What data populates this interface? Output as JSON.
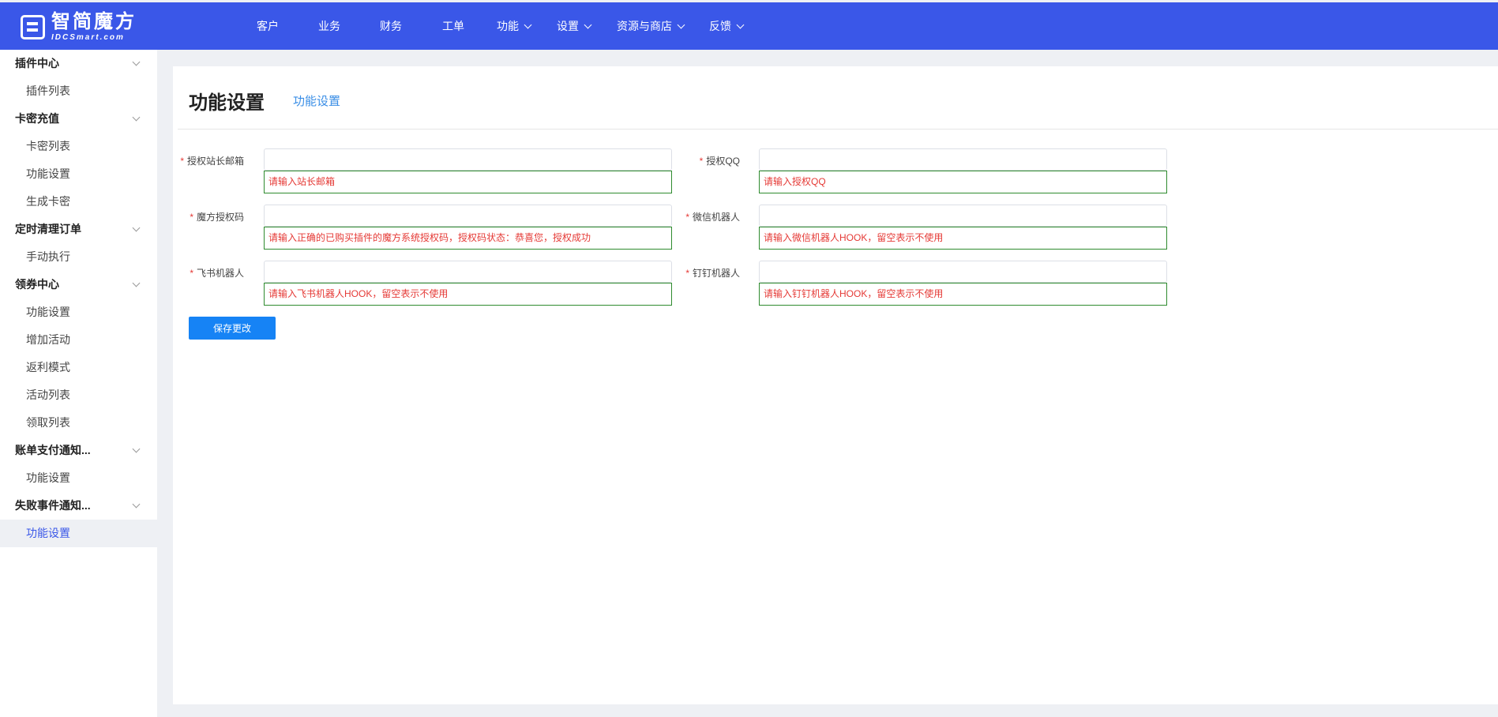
{
  "brand": {
    "name_cn": "智简魔方",
    "name_en": "IDCSmart.com"
  },
  "nav": {
    "items": [
      {
        "label": "客户",
        "has_dropdown": false
      },
      {
        "label": "业务",
        "has_dropdown": false
      },
      {
        "label": "财务",
        "has_dropdown": false
      },
      {
        "label": "工单",
        "has_dropdown": false
      },
      {
        "label": "功能",
        "has_dropdown": true
      },
      {
        "label": "设置",
        "has_dropdown": true
      },
      {
        "label": "资源与商店",
        "has_dropdown": true
      },
      {
        "label": "反馈",
        "has_dropdown": true
      }
    ]
  },
  "sidebar": {
    "groups": [
      {
        "label": "插件中心",
        "items": [
          "插件列表"
        ]
      },
      {
        "label": "卡密充值",
        "items": [
          "卡密列表",
          "功能设置",
          "生成卡密"
        ]
      },
      {
        "label": "定时清理订单",
        "items": [
          "手动执行"
        ]
      },
      {
        "label": "领券中心",
        "items": [
          "功能设置",
          "增加活动",
          "返利模式",
          "活动列表",
          "领取列表"
        ]
      },
      {
        "label": "账单支付通知...",
        "items": [
          "功能设置"
        ]
      },
      {
        "label": "失败事件通知...",
        "items": [
          "功能设置"
        ]
      }
    ],
    "active_item": "功能设置"
  },
  "page": {
    "title": "功能设置",
    "tab": "功能设置"
  },
  "form": {
    "fields": [
      {
        "label": "授权站长邮箱",
        "required": true,
        "value": "",
        "error": "请输入站长邮箱"
      },
      {
        "label": "授权QQ",
        "required": true,
        "value": "",
        "error": "请输入授权QQ"
      },
      {
        "label": "魔方授权码",
        "required": true,
        "value": "",
        "error": "请输入正确的已购买插件的魔方系统授权码，授权码状态：恭喜您，授权成功"
      },
      {
        "label": "微信机器人",
        "required": true,
        "value": "",
        "error": "请输入微信机器人HOOK，留空表示不使用"
      },
      {
        "label": "飞书机器人",
        "required": true,
        "value": "",
        "error": "请输入飞书机器人HOOK，留空表示不使用"
      },
      {
        "label": "钉钉机器人",
        "required": true,
        "value": "",
        "error": "请输入钉钉机器人HOOK，留空表示不使用"
      }
    ],
    "save_label": "保存更改"
  },
  "colors": {
    "topbar": "#3a57e8",
    "active_menu": "#3a57e8",
    "tab_link": "#3a8ee6",
    "button": "#1683f5",
    "error_text": "#e53935",
    "error_border": "#2e8b2e"
  }
}
